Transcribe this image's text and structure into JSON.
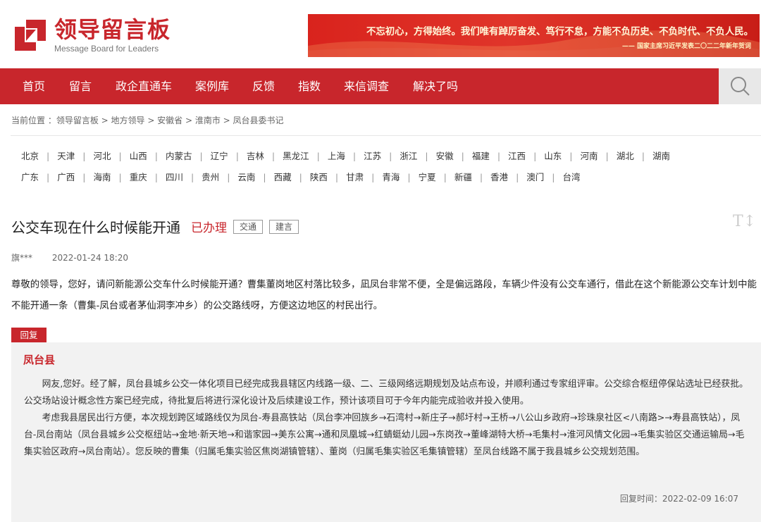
{
  "header": {
    "logo_cn": "领导留言板",
    "logo_en": "Message Board for Leaders",
    "banner_main": "不忘初心，方得始终。我们唯有踔厉奋发、笃行不怠，方能不负历史、不负时代、不负人民。",
    "banner_sub": "—— 国家主席习近平发表二〇二二年新年贺词"
  },
  "nav": {
    "items": [
      "首页",
      "留言",
      "政企直通车",
      "案例库",
      "反馈",
      "指数",
      "来信调查",
      "解决了吗"
    ]
  },
  "breadcrumb": "当前位置 ：领导留言板 > 地方领导 > 安徽省 > 淮南市 > 凤台县委书记",
  "regions": {
    "row1": [
      "北京",
      "天津",
      "河北",
      "山西",
      "内蒙古",
      "辽宁",
      "吉林",
      "黑龙江",
      "上海",
      "江苏",
      "浙江",
      "安徽",
      "福建",
      "江西",
      "山东",
      "河南",
      "湖北",
      "湖南"
    ],
    "row2": [
      "广东",
      "广西",
      "海南",
      "重庆",
      "四川",
      "贵州",
      "云南",
      "西藏",
      "陕西",
      "甘肃",
      "青海",
      "宁夏",
      "新疆",
      "香港",
      "澳门",
      "台湾"
    ]
  },
  "message": {
    "title": "公交车现在什么时候能开通",
    "status": "已办理",
    "tags": [
      "交通",
      "建言"
    ],
    "font_tool": "T↕",
    "author": "旗***",
    "time": "2022-01-24 18:20",
    "content": "尊敬的领导，您好，请问新能源公交车什么时候能开通？曹集董岗地区村落比较多，凪凤台非常不便，全是偏远路段，车辆少件没有公交车通行，借此在这个新能源公交车计划中能不能开通一条（曹集-凤台或者茅仙洞李冲乡）的公交路线呀，方便这边地区的村民出行。"
  },
  "reply": {
    "tag": "回复",
    "org": "凤台县",
    "para1": "网友,您好。经了解，凤台县城乡公交一体化项目已经完成我县辖区内线路一级、二、三级网络远期规划及站点布设，并顺利通过专家组评审。公交综合枢纽停保站选址已经获批。公交场站设计概念性方案已经完成，待批复后将进行深化设计及后续建设工作，预计该项目可于今年内能完成验收并投入使用。",
    "para2": "考虑我县居民出行方便，本次规划跨区域路线仅为凤台-寿县高铁站（凤台李冲回族乡→石湾村→新庄子→郝圩村→王桥→八公山乡政府→珍珠泉社区<八南路>→寿县高铁站），凤台-凤台南站（凤台县城乡公交枢纽站→金地·新天地→和谐家园→美东公寓→通和凤凰城→红蜻蜓幼儿园→东岗孜→董峰湖特大桥→毛集村→淮河风情文化园→毛集实验区交通运输局→毛集实验区政府→凤台南站）。您反映的曹集（归属毛集实验区焦岗湖镇管辖）、董岗（归属毛集实验区毛集镇管辖）至凤台线路不属于我县城乡公交规划范围。",
    "time": "回复时间：2022-02-09 16:07"
  }
}
